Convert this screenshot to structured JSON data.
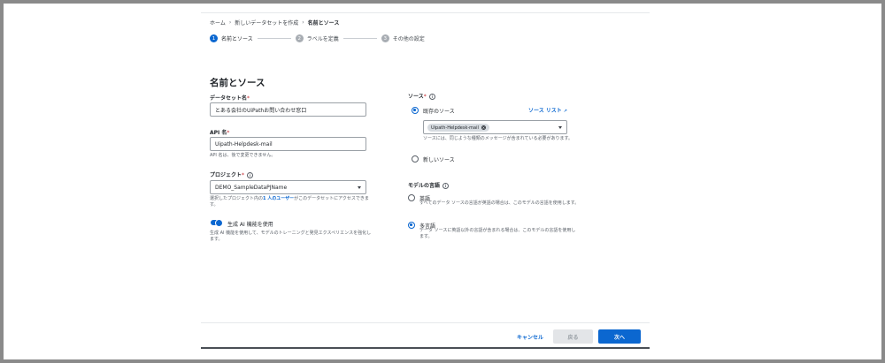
{
  "breadcrumb": {
    "items": [
      "ホーム",
      "新しいデータセットを作成",
      "名前とソース"
    ],
    "separator": "›"
  },
  "stepper": {
    "steps": [
      {
        "num": "1",
        "label": "名前とソース",
        "active": true
      },
      {
        "num": "2",
        "label": "ラベルを定義",
        "active": false
      },
      {
        "num": "3",
        "label": "その他の設定",
        "active": false
      }
    ]
  },
  "page_title": "名前とソース",
  "dataset_name": {
    "label": "データセット名",
    "required": "*",
    "value": "とある会社のUiPathお問い合わせ窓口"
  },
  "api_name": {
    "label": "API 名",
    "required": "*",
    "value": "Uipath-Helpdesk-mail",
    "helper": "API 名は、後で変更できません。"
  },
  "project": {
    "label": "プロジェクト",
    "required": "*",
    "value": "DEMO_SampleDataPJName",
    "helper_pre": "選択したプロジェクト内の",
    "helper_link": "1 人のユーザー",
    "helper_post": "がこのデータセットにアクセスできます。"
  },
  "genai": {
    "label": "生成 AI 機能を使用",
    "helper": "生成 AI 機能を使用して、モデルのトレーニングと発見エクスペリエンスを強化します。",
    "enabled": true
  },
  "source": {
    "label": "ソース",
    "required": "*",
    "existing_label": "既存のソース",
    "list_link": "ソース リスト",
    "chip": "Uipath-Helpdesk-mail",
    "helper": "ソースには、同じような種類のメッセージが含まれている必要があります。",
    "new_label": "新しいソース",
    "selected": "existing"
  },
  "model_language": {
    "label": "モデルの言語",
    "options": [
      {
        "label": "英語",
        "desc": "すべてのデータ ソースの言語が英語の場合は、このモデルの言語を使用します。",
        "checked": false
      },
      {
        "label": "多言語",
        "desc": "データ ソースに英語以外の言語が含まれる場合は、このモデルの言語を使用します。",
        "checked": true
      }
    ]
  },
  "footer": {
    "cancel": "キャンセル",
    "back": "戻る",
    "next": "次へ"
  },
  "colors": {
    "accent": "#0b67d0",
    "required": "#c2272d"
  }
}
